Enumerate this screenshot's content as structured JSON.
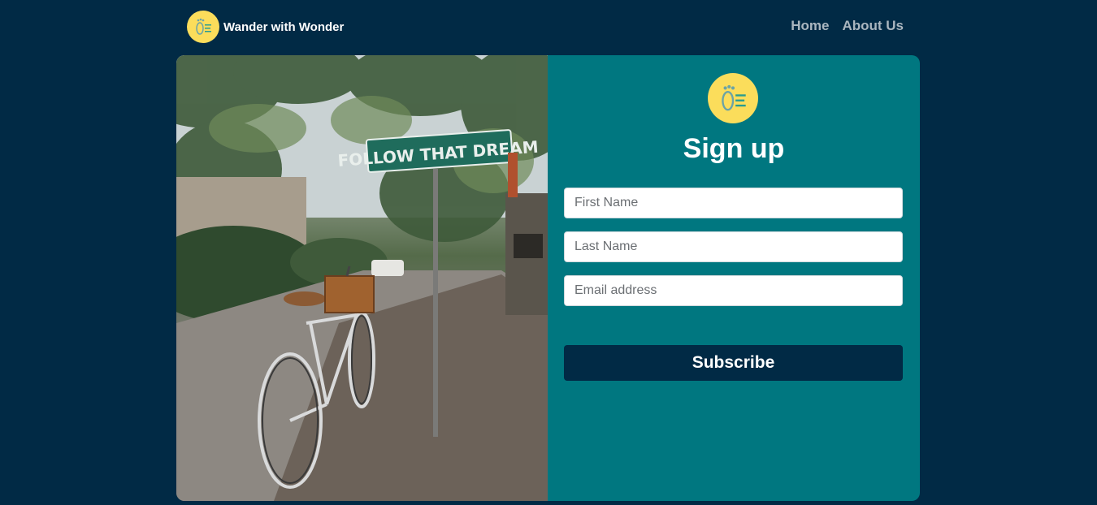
{
  "brand": {
    "name": "Wander with Wonder",
    "logo_icon": "footprint-icon",
    "logo_color": "#fbdd5b"
  },
  "nav": {
    "items": [
      {
        "label": "Home"
      },
      {
        "label": "About Us"
      }
    ]
  },
  "hero_image": {
    "sign_text": "FOLLOW THAT DREAM"
  },
  "signup": {
    "title": "Sign up",
    "first_name_placeholder": "First Name",
    "last_name_placeholder": "Last Name",
    "email_placeholder": "Email address",
    "submit_label": "Subscribe"
  },
  "colors": {
    "background": "#012a45",
    "panel": "#007780",
    "button": "#012a45",
    "accent_yellow": "#fbdd5b"
  }
}
